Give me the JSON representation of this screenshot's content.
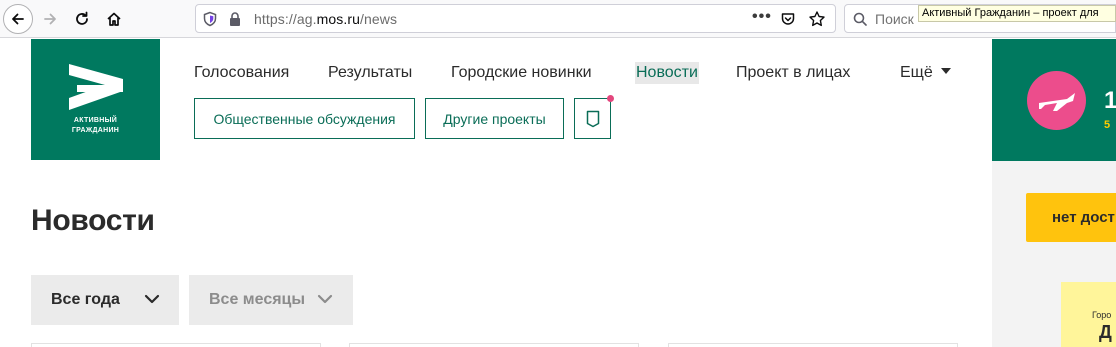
{
  "browser": {
    "url_prefix": "https://ag.",
    "url_domain": "mos.ru",
    "url_path": "/news",
    "page_actions": "•••",
    "search_placeholder": "Поиск",
    "tooltip": "Активный Гражданин – проект для"
  },
  "site": {
    "logo_line1": "АКТИВНЫЙ",
    "logo_line2": "ГРАЖДАНИН",
    "brand_color": "#00795f",
    "accent_color": "#0a6d57",
    "nav": [
      {
        "label": "Голосования"
      },
      {
        "label": "Результаты"
      },
      {
        "label": "Городские новинки"
      },
      {
        "label": "Новости"
      },
      {
        "label": "Проект в лицах"
      },
      {
        "label": "Ещё"
      }
    ],
    "buttons": {
      "discussions": "Общественные обсуждения",
      "other_projects": "Другие проекты"
    }
  },
  "page": {
    "title": "Новости",
    "filters": {
      "year": "Все года",
      "month": "Все месяцы"
    }
  },
  "sidebar": {
    "banner_partial": "1",
    "banner_sub_partial": "5",
    "access_button": "нет дост",
    "card_small": "Горо",
    "card_big": "Д"
  }
}
